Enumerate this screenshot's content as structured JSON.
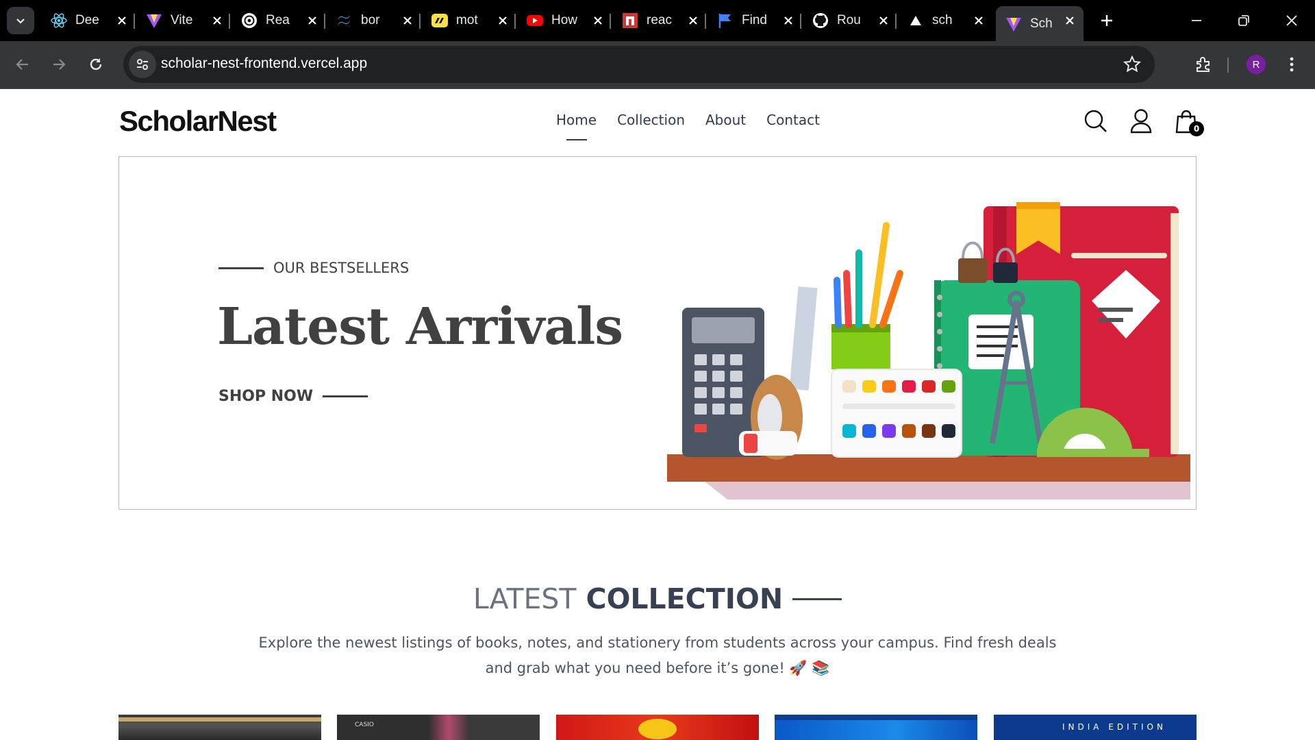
{
  "browser": {
    "tabs": [
      {
        "title": "Dee",
        "icon": "react-icon",
        "active": false
      },
      {
        "title": "Vite",
        "icon": "vite-icon",
        "active": false
      },
      {
        "title": "Rea",
        "icon": "openai-icon",
        "active": false
      },
      {
        "title": "bor",
        "icon": "tailwind-icon",
        "active": false
      },
      {
        "title": "mot",
        "icon": "motion-icon",
        "active": false
      },
      {
        "title": "How",
        "icon": "youtube-icon",
        "active": false
      },
      {
        "title": "reac",
        "icon": "npm-icon",
        "active": false
      },
      {
        "title": "Find",
        "icon": "flag-icon",
        "active": false
      },
      {
        "title": "Rou",
        "icon": "github-icon",
        "active": false
      },
      {
        "title": "sch",
        "icon": "vercel-icon",
        "active": false
      },
      {
        "title": "Sch",
        "icon": "vite-icon",
        "active": true
      }
    ],
    "url": "scholar-nest-frontend.vercel.app",
    "profile_initial": "R"
  },
  "site": {
    "logo": "ScholarNest",
    "nav": [
      {
        "label": "Home",
        "active": true
      },
      {
        "label": "Collection",
        "active": false
      },
      {
        "label": "About",
        "active": false
      },
      {
        "label": "Contact",
        "active": false
      }
    ],
    "cart_count": "0"
  },
  "hero": {
    "eyebrow": "OUR BESTSELLERS",
    "title": "Latest Arrivals",
    "cta": "SHOP NOW"
  },
  "collection": {
    "title_light": "LATEST",
    "title_bold": "COLLECTION",
    "description_line1": "Explore the newest listings of books, notes, and stationery from students across your campus. Find fresh deals",
    "description_line2": "and grab what you need before it’s gone! 🚀 📚"
  },
  "products": [
    {
      "label": ""
    },
    {
      "label": "CASIO"
    },
    {
      "label": ""
    },
    {
      "label": ""
    },
    {
      "label": "INDIA EDITION"
    }
  ],
  "colors": {
    "chrome_bg": "#000000",
    "toolbar_bg": "#353639",
    "text_dark": "#414141",
    "accent_purple": "#7b1fa2"
  }
}
